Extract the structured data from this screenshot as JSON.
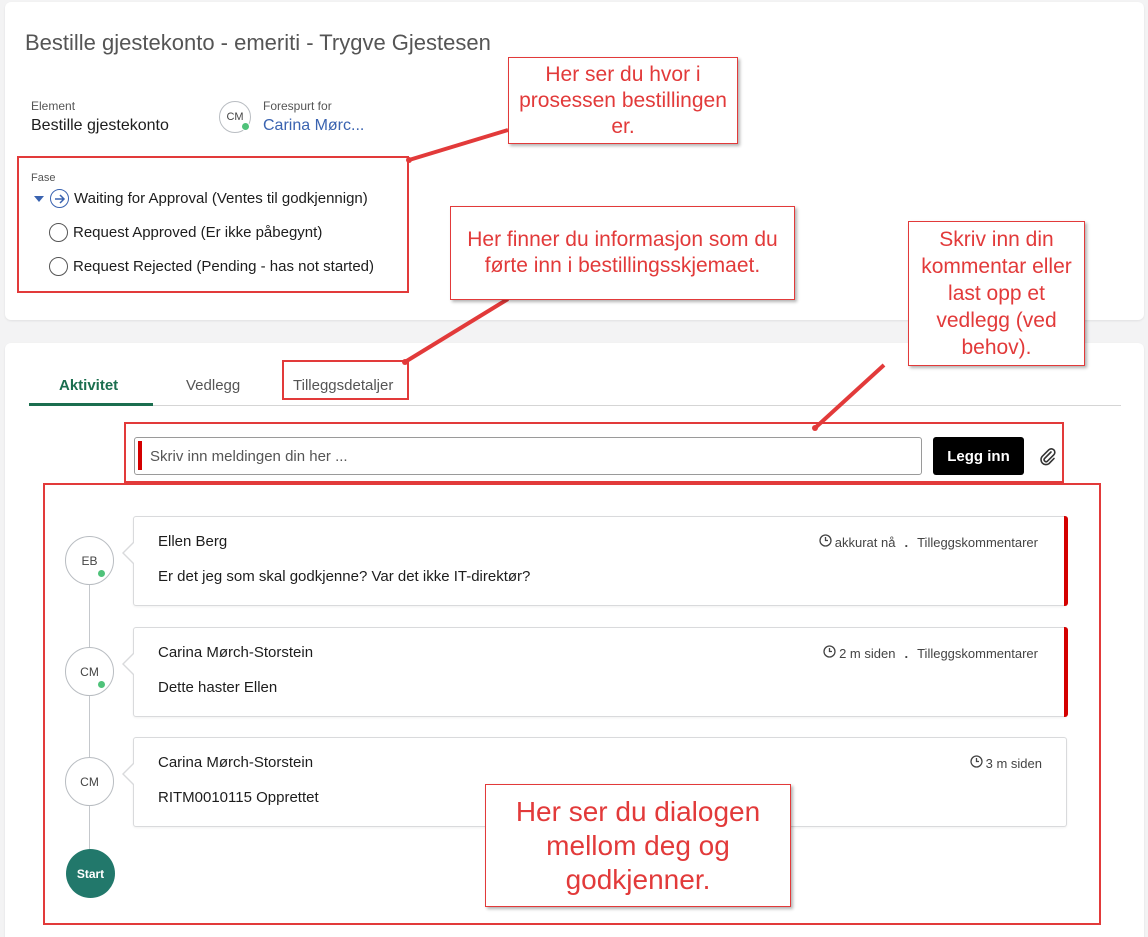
{
  "header": {
    "title": "Bestille gjestekonto - emeriti - Trygve Gjestesen",
    "element_label": "Element",
    "element_value": "Bestille gjestekonto",
    "requested_for_label": "Forespurt for",
    "requested_for_initials": "CM",
    "requested_for_value": "Carina Mørc..."
  },
  "stage": {
    "label": "Fase",
    "items": [
      {
        "label": "Waiting for Approval (Ventes til godkjennign)",
        "state": "current"
      },
      {
        "label": "Request Approved (Er ikke påbegynt)",
        "state": "pending"
      },
      {
        "label": "Request Rejected (Pending - has not started)",
        "state": "pending"
      }
    ]
  },
  "tabs": [
    {
      "label": "Aktivitet",
      "active": true
    },
    {
      "label": "Vedlegg",
      "active": false
    },
    {
      "label": "Tilleggsdetaljer",
      "active": false
    }
  ],
  "composer": {
    "placeholder": "Skriv inn meldingen din her ...",
    "post_label": "Legg inn",
    "attach_icon": "paperclip-icon"
  },
  "activity": [
    {
      "initials": "EB",
      "author": "Ellen Berg",
      "time": "akkurat nå",
      "type": "Tilleggskommentarer",
      "text": "Er det jeg som skal godkjenne? Var det ikke IT-direktør?",
      "online": true
    },
    {
      "initials": "CM",
      "author": "Carina Mørch-Storstein",
      "time": "2 m siden",
      "type": "Tilleggskommentarer",
      "text": "Dette haster Ellen",
      "online": true
    },
    {
      "initials": "CM",
      "author": "Carina Mørch-Storstein",
      "time": "3 m siden",
      "type": "",
      "text": "RITM0010115 Opprettet",
      "online": false
    }
  ],
  "timeline_start": "Start",
  "callouts": {
    "stage": "Her ser du hvor i prosessen bestillingen er.",
    "details": "Her finner du informasjon som du førte inn i bestillingsskjemaet.",
    "comment": "Skriv inn din kommentar eller last opp et vedlegg (ved behov).",
    "dialog": "Her ser du dialogen mellom deg og godkjenner."
  },
  "colors": {
    "accent_green": "#1b6e4f",
    "start_teal": "#22786b",
    "link_blue": "#3a63b0",
    "annotation_red": "#e23a3a",
    "online_green": "#4fc27a"
  }
}
